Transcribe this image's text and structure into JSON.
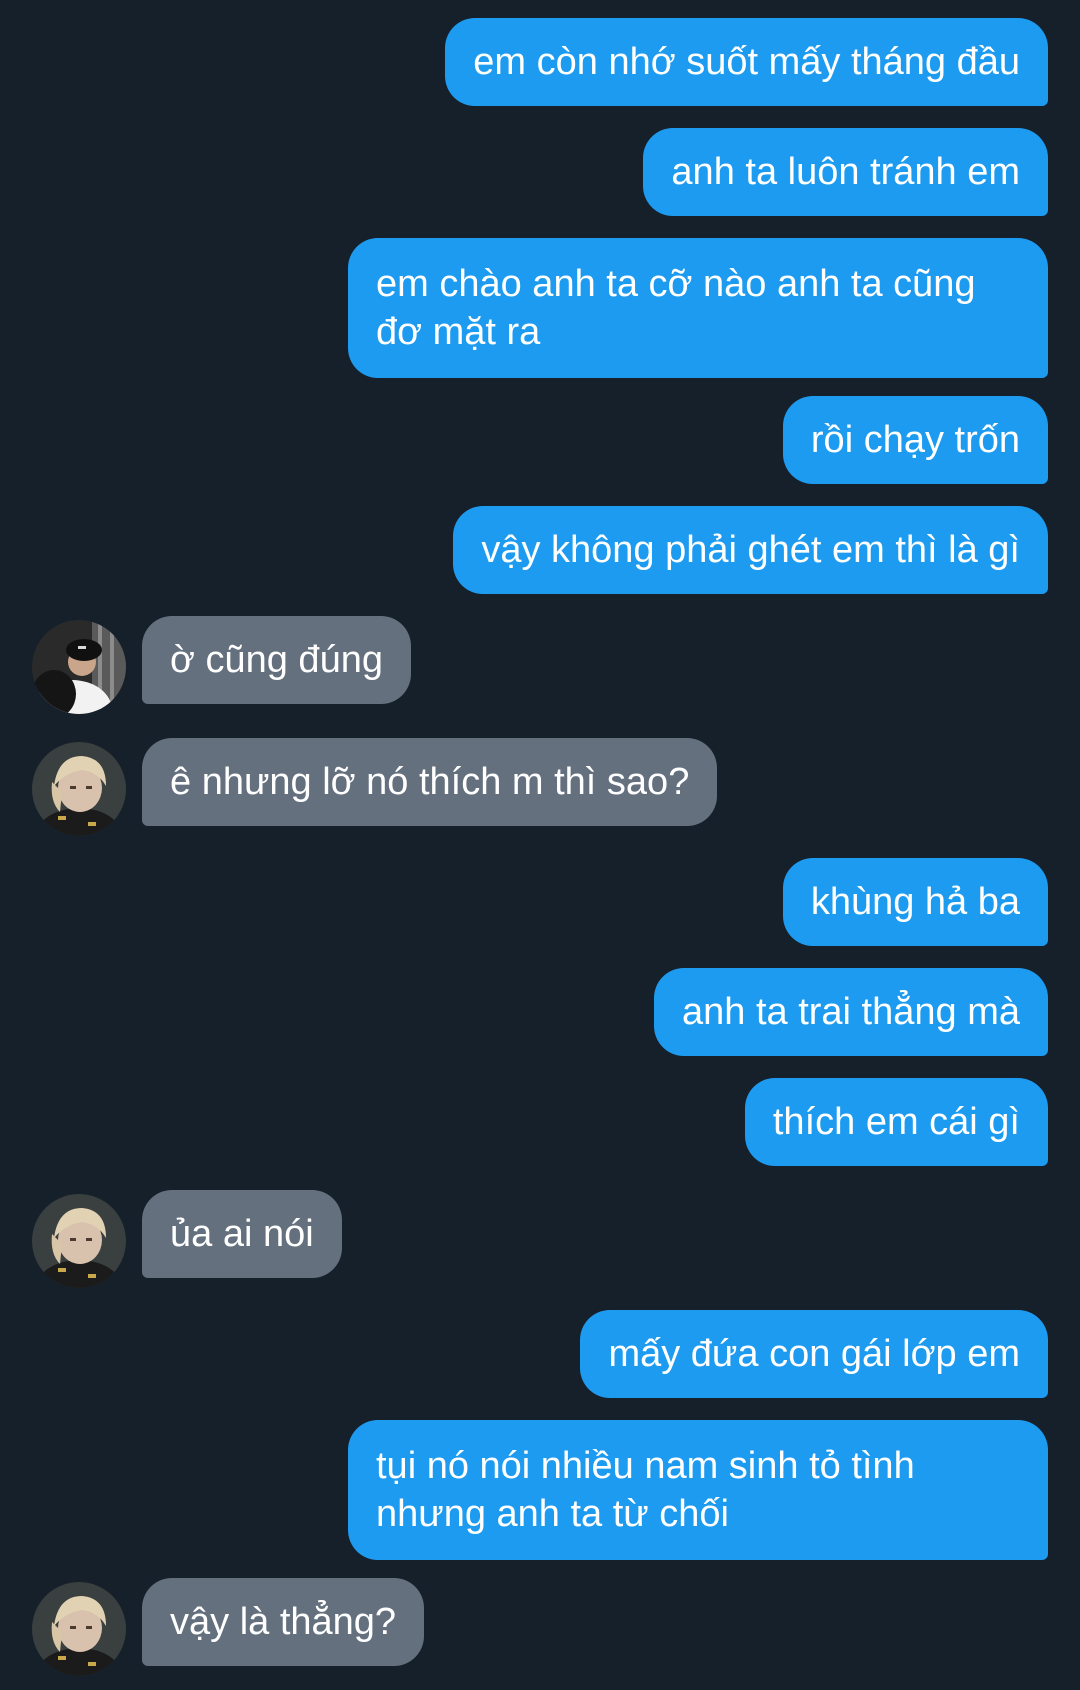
{
  "conversation": {
    "messages": [
      {
        "text": "em còn nhớ suốt mấy tháng đầu"
      },
      {
        "text": "anh ta luôn tránh em"
      },
      {
        "text": "em chào anh ta cỡ nào anh ta cũng đơ mặt ra"
      },
      {
        "text": "rồi chạy trốn"
      },
      {
        "text": "vậy không phải ghét em thì là gì"
      },
      {
        "text": "ờ cũng đúng"
      },
      {
        "text": "ê nhưng lỡ nó thích m thì sao?"
      },
      {
        "text": "khùng hả ba"
      },
      {
        "text": "anh ta trai thẳng mà"
      },
      {
        "text": "thích em cái gì"
      },
      {
        "text": "ủa ai nói"
      },
      {
        "text": "mấy đứa con gái lớp em"
      },
      {
        "text": "tụi nó nói nhiều nam sinh tỏ tình nhưng anh ta từ chối"
      },
      {
        "text": "vậy là thẳng?"
      }
    ]
  },
  "colors": {
    "background": "#16202b",
    "outgoing_bubble": "#1d9bf0",
    "incoming_bubble": "#64707e",
    "text": "#ffffff"
  },
  "icons": {
    "avatar_a": "avatar-dark-cap-icon",
    "avatar_b": "avatar-blond-icon"
  }
}
